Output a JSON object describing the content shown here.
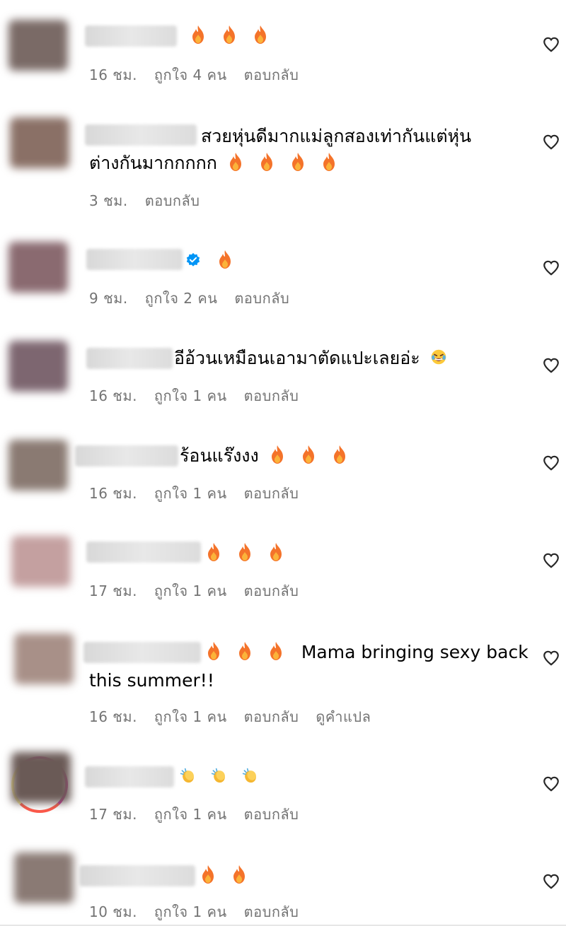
{
  "comments": [
    {
      "text": "",
      "emojis": [
        "fire",
        "fire",
        "fire"
      ],
      "time": "16 ชม.",
      "likes": "ถูกใจ 4 คน",
      "reply": "ตอบกลับ",
      "avatar_color": "#7a6a66"
    },
    {
      "text1": "สวยหุ่นดีมากแม่ลูกสองเท่ากันแต่หุ่น",
      "text2": "ต่างกันมากกกกก",
      "emojis": [
        "fire",
        "fire",
        "fire",
        "fire"
      ],
      "time": "3 ชม.",
      "reply": "ตอบกลับ",
      "avatar_color": "#8a7066"
    },
    {
      "text": "",
      "emojis": [
        "fire"
      ],
      "verified": true,
      "time": "9 ชม.",
      "likes": "ถูกใจ 2 คน",
      "reply": "ตอบกลับ",
      "avatar_color": "#8a6a70"
    },
    {
      "text": "อีอ้วนเหมือนเอามาตัดแปะเลยอ่ะ",
      "emojis": [
        "laugh"
      ],
      "time": "16 ชม.",
      "likes": "ถูกใจ 1 คน",
      "reply": "ตอบกลับ",
      "avatar_color": "#7d6670"
    },
    {
      "text": "ร้อนแร๊งงง",
      "emojis": [
        "fire",
        "fire",
        "fire"
      ],
      "time": "16 ชม.",
      "likes": "ถูกใจ 1 คน",
      "reply": "ตอบกลับ",
      "avatar_color": "#8a7a72"
    },
    {
      "text": "",
      "emojis": [
        "fire",
        "fire",
        "fire"
      ],
      "time": "17 ชม.",
      "likes": "ถูกใจ 1 คน",
      "reply": "ตอบกลับ",
      "avatar_color": "#c4a0a0"
    },
    {
      "text1": "Mama bringing sexy back",
      "text2": "this summer!!",
      "emojis": [
        "fire",
        "fire",
        "fire"
      ],
      "time": "16 ชม.",
      "likes": "ถูกใจ 1 คน",
      "reply": "ตอบกลับ",
      "translate": "ดูคำแปล",
      "avatar_color": "#a89088"
    },
    {
      "text": "",
      "emojis": [
        "clap",
        "clap",
        "clap"
      ],
      "time": "17 ชม.",
      "likes": "ถูกใจ 1 คน",
      "reply": "ตอบกลับ",
      "avatar_color": "#6a5a56"
    },
    {
      "text": "",
      "emojis": [
        "fire",
        "fire"
      ],
      "time": "10 ชม.",
      "likes": "ถูกใจ 1 คน",
      "reply": "ตอบกลับ",
      "avatar_color": "#8a7a74"
    }
  ],
  "colors": {
    "meta": "#737373",
    "text": "#000000",
    "verified": "#0095f6",
    "fire": "#f4732a"
  },
  "icons": {
    "like": "heart-outline-icon",
    "fire": "fire-emoji-icon",
    "laugh": "laughing-emoji-icon",
    "clap": "clapping-hands-emoji-icon",
    "verified": "verified-badge-icon"
  }
}
